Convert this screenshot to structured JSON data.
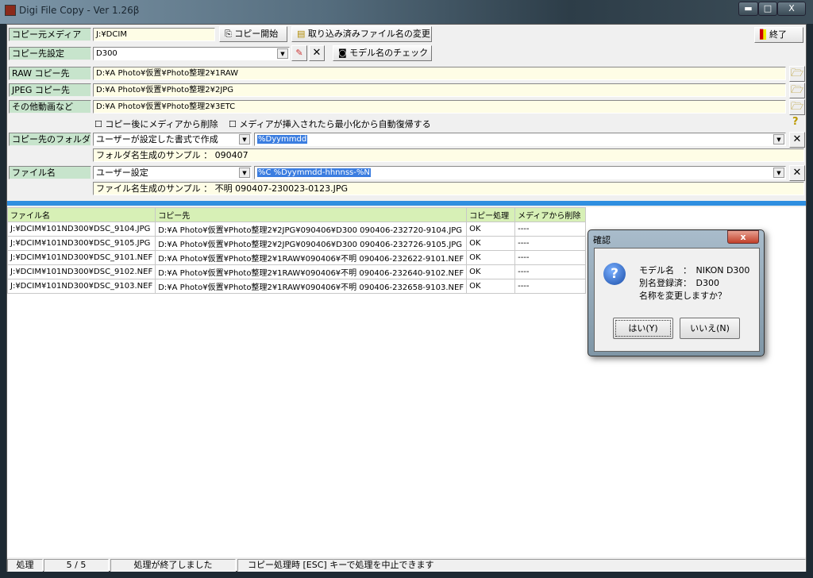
{
  "window": {
    "title": "Digi File Copy  - Ver 1.26β",
    "minimize": "▬",
    "maximize": "□",
    "close": "X"
  },
  "form": {
    "source_label": "コピー元メディア",
    "source_value": "J:¥DCIM",
    "copy_start": "コピー開始",
    "rename_imported": "取り込み済みファイル名の変更",
    "exit": "終了",
    "dest_setting_label": "コピー先設定",
    "dest_setting_value": "D300",
    "model_check": "モデル名のチェック",
    "raw_label": "RAW コピー先",
    "raw_value": "D:¥A Photo¥仮置¥Photo整理2¥1RAW",
    "jpeg_label": "JPEG コピー先",
    "jpeg_value": "D:¥A Photo¥仮置¥Photo整理2¥2JPG",
    "other_label": "その他動画など",
    "other_value": "D:¥A Photo¥仮置¥Photo整理2¥3ETC",
    "cb_delete": "コピー後にメディアから削除",
    "cb_restore": "メディアが挿入されたら最小化から自動復帰する",
    "folder_label": "コピー先のフォルダ",
    "folder_mode": "ユーザーが設定した書式で作成",
    "folder_format": "%Dyymmdd",
    "folder_sample": "フォルダ名生成のサンプル ： 090407",
    "filename_label": "ファイル名",
    "filename_mode": "ユーザー設定",
    "filename_format": "%C %Dyymmdd-hhnnss-%N",
    "filename_sample": "ファイル名生成のサンプル ： 不明 090407-230023-0123.JPG"
  },
  "table": {
    "headers": [
      "ファイル名",
      "コピー先",
      "コピー処理",
      "メディアから削除"
    ],
    "rows": [
      [
        "J:¥DCIM¥101ND300¥DSC_9104.JPG",
        "D:¥A Photo¥仮置¥Photo整理2¥2JPG¥090406¥D300 090406-232720-9104.JPG",
        "OK",
        "----"
      ],
      [
        "J:¥DCIM¥101ND300¥DSC_9105.JPG",
        "D:¥A Photo¥仮置¥Photo整理2¥2JPG¥090406¥D300 090406-232726-9105.JPG",
        "OK",
        "----"
      ],
      [
        "J:¥DCIM¥101ND300¥DSC_9101.NEF",
        "D:¥A Photo¥仮置¥Photo整理2¥1RAW¥090406¥不明 090406-232622-9101.NEF",
        "OK",
        "----"
      ],
      [
        "J:¥DCIM¥101ND300¥DSC_9102.NEF",
        "D:¥A Photo¥仮置¥Photo整理2¥1RAW¥090406¥不明 090406-232640-9102.NEF",
        "OK",
        "----"
      ],
      [
        "J:¥DCIM¥101ND300¥DSC_9103.NEF",
        "D:¥A Photo¥仮置¥Photo整理2¥1RAW¥090406¥不明 090406-232658-9103.NEF",
        "OK",
        "----"
      ]
    ]
  },
  "status": {
    "label": "処理",
    "progress": "5 / 5",
    "message": "処理が終了しました",
    "hint": "コピー処理時 [ESC] キーで処理を中止できます"
  },
  "dialog": {
    "title": "確認",
    "close": "x",
    "line1": "モデル名　：　NIKON D300",
    "line2": "別名登録済：　D300",
    "line3": "名称を変更しますか？",
    "yes": "はい(Y)",
    "no": "いいえ(N)"
  }
}
